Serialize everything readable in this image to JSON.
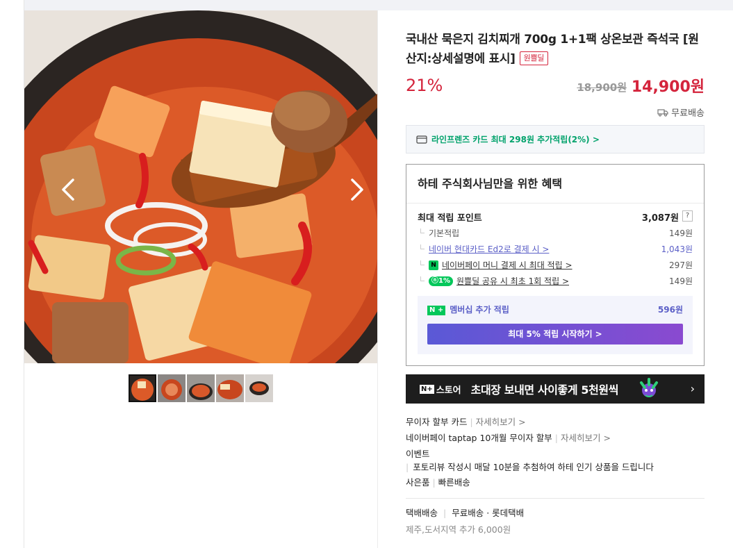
{
  "gallery": {
    "prev_icon": "chevron-left-icon",
    "next_icon": "chevron-right-icon",
    "thumbnail_count": 5
  },
  "product": {
    "title": "국내산 묵은지 김치찌개 700g 1+1팩 상온보관 즉석국 [원산지:상세설명에 표시]",
    "badge": "원쁠딜",
    "discount": "21%",
    "original_price": "18,900원",
    "sale_price": "14,900원",
    "shipping_label": "무료배송"
  },
  "card_promo": {
    "text": "라인프렌즈 카드 최대 298원 추가적립(2%) >"
  },
  "benefits": {
    "title": "하테 주식회사님만을 위한 혜택",
    "max_points_label": "최대 적립 포인트",
    "max_points_value": "3,087원",
    "help": "?",
    "rows": [
      {
        "label": "기본적립",
        "value": "149원"
      },
      {
        "label": "네이버 현대카드 Ed2로 결제 시 >",
        "value": "1,043원"
      },
      {
        "label": "네이버페이 머니 결제 시 최대 적립 >",
        "value": "297원",
        "mark": "N"
      },
      {
        "label": "원쁠딜 공유 시 최초 1회 적립 >",
        "value": "149원",
        "mark": "ⓝ1%"
      }
    ],
    "membership_mark": "N +",
    "membership_label": "멤버십 추가 적립",
    "membership_value": "596원",
    "membership_button": "최대 5% 적립 시작하기 >"
  },
  "banner": {
    "store_mark": "N+",
    "store_label": "스토어",
    "message": "초대장 보내면 사이좋게 5천원씩",
    "chevron": "›"
  },
  "details": {
    "installment_label": "무이자 할부 카드",
    "installment_more": "자세히보기 >",
    "taptap_label": "네이버페이 taptap 10개월 무이자 할부",
    "taptap_more": "자세히보기 >",
    "event_label": "이벤트",
    "event_text": "포토리뷰 작성시 매달 10분을 추첨하여 하테 인기 상품을 드립니다",
    "gift_label": "사은품",
    "gift_text": "빠른배송",
    "delivery_label": "택배배송",
    "delivery_text": "무료배송 · 롯데택배",
    "delivery_extra": "제주,도서지역 추가 6,000원"
  },
  "colors": {
    "accent_red": "#d4243c",
    "naver_green": "#03c75a",
    "membership_purple": "#5b5fc7"
  }
}
